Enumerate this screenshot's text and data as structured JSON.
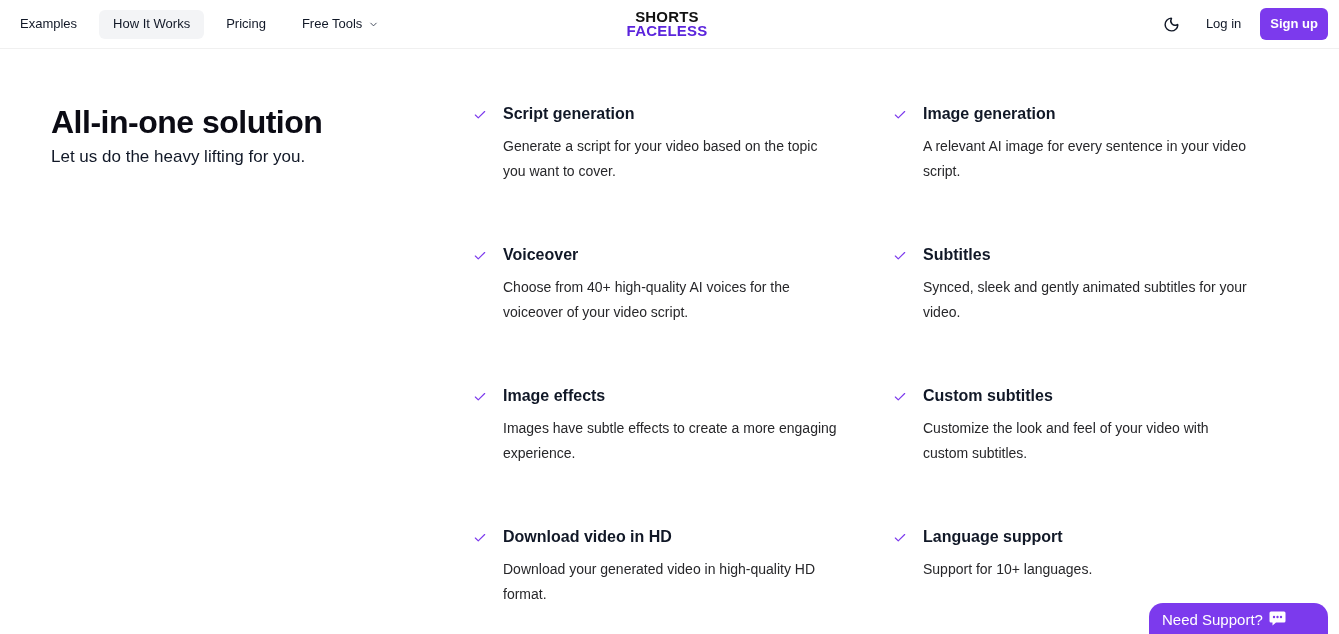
{
  "nav": {
    "links": [
      {
        "label": "Examples",
        "selected": false,
        "kind": "link"
      },
      {
        "label": "How It Works",
        "selected": true,
        "kind": "link"
      },
      {
        "label": "Pricing",
        "selected": false,
        "kind": "link"
      },
      {
        "label": "Free Tools",
        "selected": false,
        "kind": "dropdown"
      }
    ],
    "logo": {
      "line_1": "SHORTS",
      "line_2": "FACELESS"
    },
    "login": "Log in",
    "signup": "Sign up"
  },
  "hero": {
    "title": "All-in-one solution",
    "subtitle": "Let us do the heavy lifting for you."
  },
  "features": [
    {
      "title": "Script generation",
      "description": "Generate a script for your video based on the topic you want to cover."
    },
    {
      "title": "Image generation",
      "description": "A relevant AI image for every sentence in your video script."
    },
    {
      "title": "Voiceover",
      "description": "Choose from 40+ high-quality AI voices for the voiceover of your video script."
    },
    {
      "title": "Subtitles",
      "description": "Synced, sleek and gently animated subtitles for your video."
    },
    {
      "title": "Image effects",
      "description": "Images have subtle effects to create a more engaging experience."
    },
    {
      "title": "Custom subtitles",
      "description": "Customize the look and feel of your video with custom subtitles."
    },
    {
      "title": "Download video in HD",
      "description": "Download your generated video in high-quality HD format."
    },
    {
      "title": "Language support",
      "description": "Support for 10+ languages."
    }
  ],
  "support_button": {
    "label": "Need Support?"
  }
}
